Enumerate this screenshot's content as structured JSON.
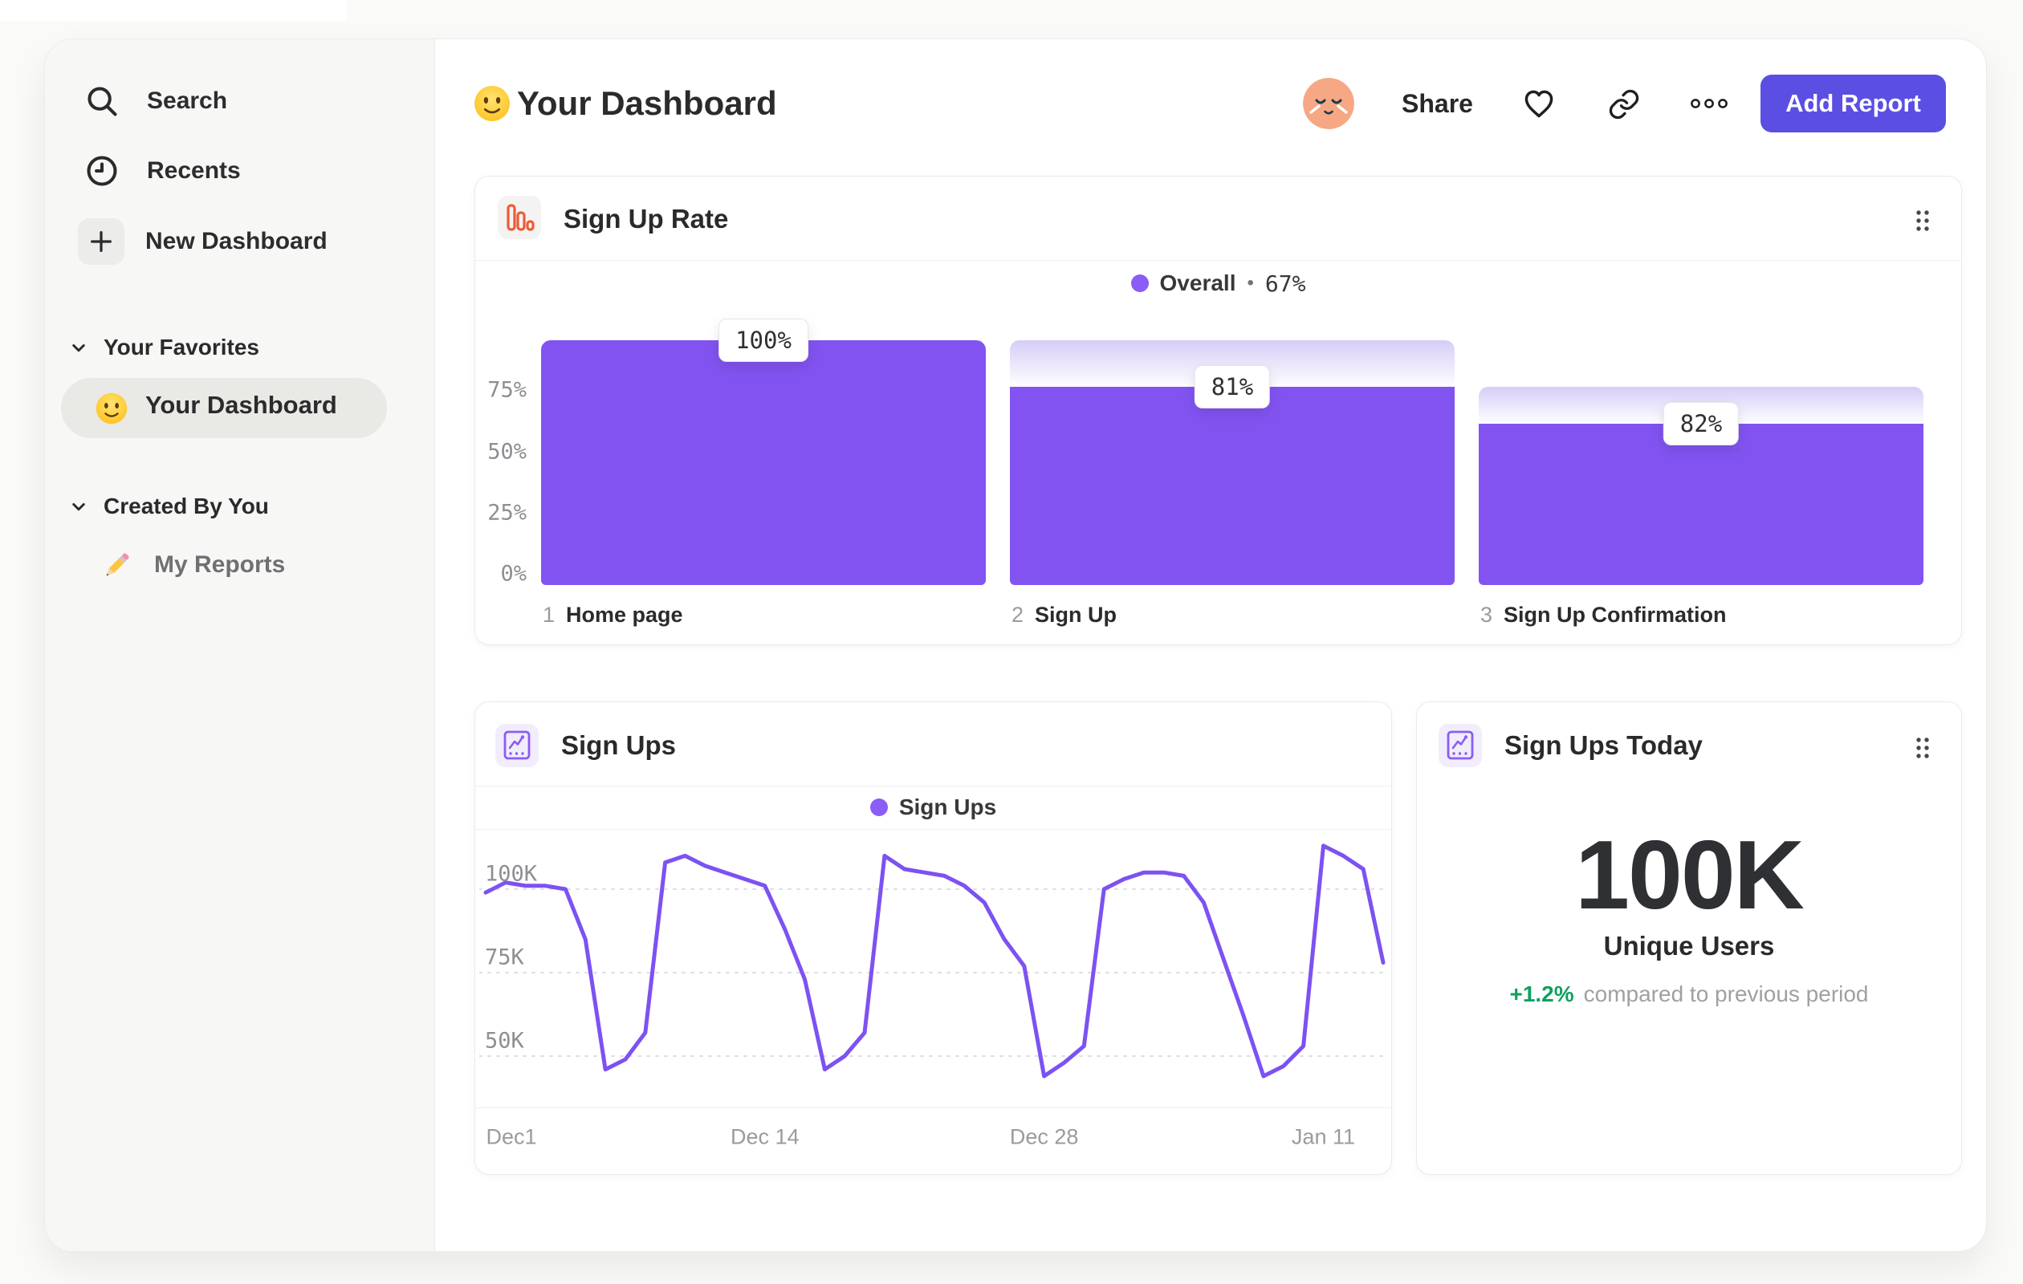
{
  "sidebar": {
    "nav": [
      {
        "label": "Search"
      },
      {
        "label": "Recents"
      },
      {
        "label": "New Dashboard"
      }
    ],
    "sections": [
      {
        "label": "Your Favorites",
        "items": [
          {
            "label": "Your Dashboard",
            "selected": true
          }
        ]
      },
      {
        "label": "Created By You",
        "items": [
          {
            "label": "My Reports",
            "selected": false
          }
        ]
      }
    ]
  },
  "header": {
    "title": "Your Dashboard",
    "share": "Share",
    "add_report": "Add Report"
  },
  "funnel_card": {
    "title": "Sign Up Rate",
    "legend_name": "Overall",
    "legend_sep": "•",
    "legend_value": "67%"
  },
  "signups_card": {
    "title": "Sign Ups",
    "legend_name": "Sign Ups"
  },
  "today_card": {
    "title": "Sign Ups Today",
    "value": "100K",
    "metric": "Unique Users",
    "delta": "+1.2%",
    "comparison": "compared to previous period"
  },
  "colors": {
    "bar_purple": "#8253F1",
    "line_purple": "#7C52F2",
    "legend_purple": "#8B5CF6",
    "button_purple": "#5B4FE3",
    "icon_orange": "#EE5A36",
    "delta_green": "#0FA060"
  },
  "chart_data": [
    {
      "type": "bar",
      "variant": "funnel",
      "title": "Sign Up Rate",
      "legend": [
        {
          "name": "Overall",
          "value": "67%",
          "color": "#8B5CF6"
        }
      ],
      "step_numbers": [
        "1",
        "2",
        "3"
      ],
      "categories": [
        "Home page",
        "Sign Up",
        "Sign Up Confirmation"
      ],
      "step_conversion_pct": [
        100,
        81,
        82
      ],
      "overall_pct": [
        100,
        81,
        66
      ],
      "value_labels": [
        "100%",
        "81%",
        "82%"
      ],
      "y_ticks": [
        {
          "label": "75%",
          "value": 75
        },
        {
          "label": "50%",
          "value": 50
        },
        {
          "label": "25%",
          "value": 25
        },
        {
          "label": "0%",
          "value": 0
        }
      ],
      "ylim": [
        0,
        100
      ],
      "bar_color": "#8253F1",
      "grid": "off",
      "legend_position": "top-center"
    },
    {
      "type": "line",
      "title": "Sign Ups",
      "series": [
        {
          "name": "Sign Ups",
          "color": "#7C52F2",
          "values": [
            99,
            102,
            101,
            101,
            100,
            85,
            46,
            49,
            57,
            108,
            110,
            107,
            105,
            103,
            101,
            88,
            73,
            46,
            50,
            57,
            110,
            106,
            105,
            104,
            101,
            96,
            85,
            77,
            44,
            48,
            53,
            100,
            103,
            105,
            105,
            104,
            96,
            79,
            62,
            44,
            47,
            53,
            113,
            110,
            106,
            78
          ]
        }
      ],
      "unit": "K",
      "x_ticks": [
        {
          "label": "Dec1",
          "day": 1
        },
        {
          "label": "Dec 14",
          "day": 14
        },
        {
          "label": "Dec 28",
          "day": 28
        },
        {
          "label": "Jan 11",
          "day": 42
        }
      ],
      "y_ticks": [
        {
          "label": "100K",
          "value": 100
        },
        {
          "label": "75K",
          "value": 75
        },
        {
          "label": "50K",
          "value": 50
        }
      ],
      "ylim": [
        35,
        116
      ],
      "grid": "dashed-horizontal",
      "legend_position": "top-center"
    },
    {
      "type": "big-number",
      "title": "Sign Ups Today",
      "value": "100K",
      "metric": "Unique Users",
      "delta": "+1.2%",
      "delta_positive": true,
      "comparison": "compared to previous period"
    }
  ]
}
